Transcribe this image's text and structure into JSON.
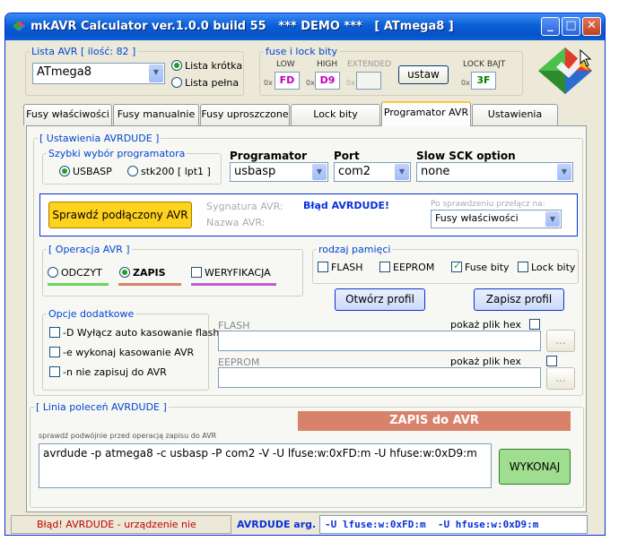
{
  "window": {
    "title": "mkAVR Calculator ver.1.0.0 build 55   *** DEMO ***   [ ATmega8 ]",
    "min": "_",
    "max": "□",
    "close": "✕"
  },
  "avr_list": {
    "legend": "Lista AVR [ ilość: 82 ]",
    "selected": "ATmega8",
    "radio_short": "Lista krótka",
    "radio_full": "Lista pełna"
  },
  "fuse": {
    "legend": "fuse i lock bity",
    "low_label": "LOW",
    "high_label": "HIGH",
    "ext_label": "EXTENDED",
    "lock_label": "LOCK BAJT",
    "prefix": "0x",
    "low_value": "FD",
    "high_value": "D9",
    "ext_value": "",
    "lock_value": "3F",
    "set_button": "ustaw"
  },
  "tabs": [
    "Fusy właściwości",
    "Fusy manualnie",
    "Fusy uproszczone",
    "Lock bity",
    "Programator AVR",
    "Ustawienia"
  ],
  "avrdude": {
    "legend": "[ Ustawienia AVRDUDE ]",
    "quick_legend": "Szybki wybór programatora",
    "quick_usbasp": "USBASP",
    "quick_stk200": "stk200 [ lpt1 ]",
    "programmer_label": "Programator",
    "programmer_value": "usbasp",
    "port_label": "Port",
    "port_value": "com2",
    "sck_label": "Slow SCK option",
    "sck_value": "none"
  },
  "check": {
    "button": "Sprawdź podłączony AVR",
    "signature_label": "Sygnatura AVR:",
    "signature_value": "Błąd AVRDUDE!",
    "name_label": "Nazwa AVR:",
    "after_label": "Po sprawdzeniu przełącz na:",
    "after_value": "Fusy właściwości"
  },
  "operation": {
    "legend": "[ Operacja AVR ]",
    "read": "ODCZYT",
    "write": "ZAPIS",
    "verify": "WERYFIKACJA"
  },
  "memory": {
    "legend": "rodzaj pamięci",
    "flash": "FLASH",
    "eeprom": "EEPROM",
    "fuse": "Fuse bity",
    "lock": "Lock bity"
  },
  "profile": {
    "open": "Otwórz profil",
    "save": "Zapisz profil"
  },
  "extra": {
    "legend": "Opcje dodatkowe",
    "opt1": "-D Wyłącz auto kasowanie flash",
    "opt2": "-e wykonaj kasowanie AVR",
    "opt3": "-n nie zapisuj do AVR"
  },
  "files": {
    "flash_label": "FLASH",
    "eeprom_label": "EEPROM",
    "show_hex": "pokaż plik hex",
    "browse": "..."
  },
  "cmdline": {
    "legend": "[ Linia poleceń AVRDUDE ]",
    "banner": "ZAPIS do AVR",
    "note": "sprawdź podwójnie przed operacją zapisu do AVR",
    "command": "avrdude -p atmega8 -c usbasp -P com2 -V -U lfuse:w:0xFD:m -U hfuse:w:0xD9:m",
    "execute": "WYKONAJ"
  },
  "status": {
    "error": "Błąd! AVRDUDE - urządzenie nie gotowe",
    "args_label": "AVRDUDE arg.",
    "args_value": "-U lfuse:w:0xFD:m  -U hfuse:w:0xD9:m"
  },
  "colors": {
    "accent_blue": "#0046d5",
    "fuse_value": "#c000c0",
    "lock_value": "#008000",
    "check_button": "#ffd21e",
    "banner": "#d9826b",
    "execute": "#9ede8e",
    "read_line": "#6fcf5f",
    "write_line": "#d9826b",
    "verify_line": "#c05ecf"
  }
}
